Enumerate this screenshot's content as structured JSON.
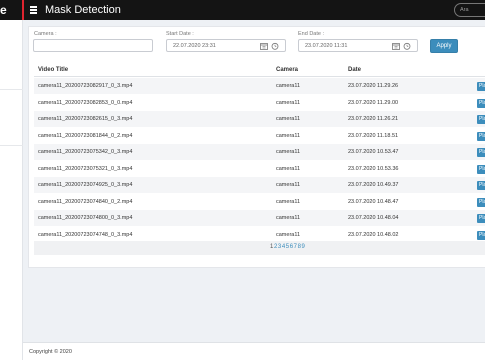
{
  "header": {
    "brand_glyph": "e",
    "title": "Mask Detection",
    "search_placeholder": "Ara"
  },
  "filters": {
    "camera_label": "Camera :",
    "camera_value": "",
    "start_label": "Start Date :",
    "start_value": "22.07.2020 23:31",
    "end_label": "End Date :",
    "end_value": "23.07.2020 11:31",
    "apply_label": "Apply"
  },
  "table": {
    "columns": [
      "Video Title",
      "Camera",
      "Date"
    ],
    "action_label": "Play",
    "rows": [
      {
        "title": "camera11_20200723082917_0_3.mp4",
        "camera": "camera11",
        "date": "23.07.2020 11.29.26"
      },
      {
        "title": "camera11_20200723082853_0_0.mp4",
        "camera": "camera11",
        "date": "23.07.2020 11.29.00"
      },
      {
        "title": "camera11_20200723082615_0_3.mp4",
        "camera": "camera11",
        "date": "23.07.2020 11.26.21"
      },
      {
        "title": "camera11_20200723081844_0_2.mp4",
        "camera": "camera11",
        "date": "23.07.2020 11.18.51"
      },
      {
        "title": "camera11_20200723075342_0_3.mp4",
        "camera": "camera11",
        "date": "23.07.2020 10.53.47"
      },
      {
        "title": "camera11_20200723075321_0_3.mp4",
        "camera": "camera11",
        "date": "23.07.2020 10.53.36"
      },
      {
        "title": "camera11_20200723074925_0_3.mp4",
        "camera": "camera11",
        "date": "23.07.2020 10.49.37"
      },
      {
        "title": "camera11_20200723074840_0_2.mp4",
        "camera": "camera11",
        "date": "23.07.2020 10.48.47"
      },
      {
        "title": "camera11_20200723074800_0_3.mp4",
        "camera": "camera11",
        "date": "23.07.2020 10.48.04"
      },
      {
        "title": "camera11_20200723074748_0_3.mp4",
        "camera": "camera11",
        "date": "23.07.2020 10.48.02"
      }
    ]
  },
  "pagination": {
    "pages": [
      "1",
      "2",
      "3",
      "4",
      "5",
      "6",
      "7",
      "8",
      "9"
    ],
    "current": "1"
  },
  "footer": {
    "text": "Copyright © 2020"
  },
  "colors": {
    "accent": "#3c8dbc",
    "topbar": "#141414",
    "brand_divider": "#e0242f"
  },
  "icons": {
    "menu": "hamburger-icon",
    "calendar": "calendar-icon",
    "clock": "clock-icon"
  }
}
